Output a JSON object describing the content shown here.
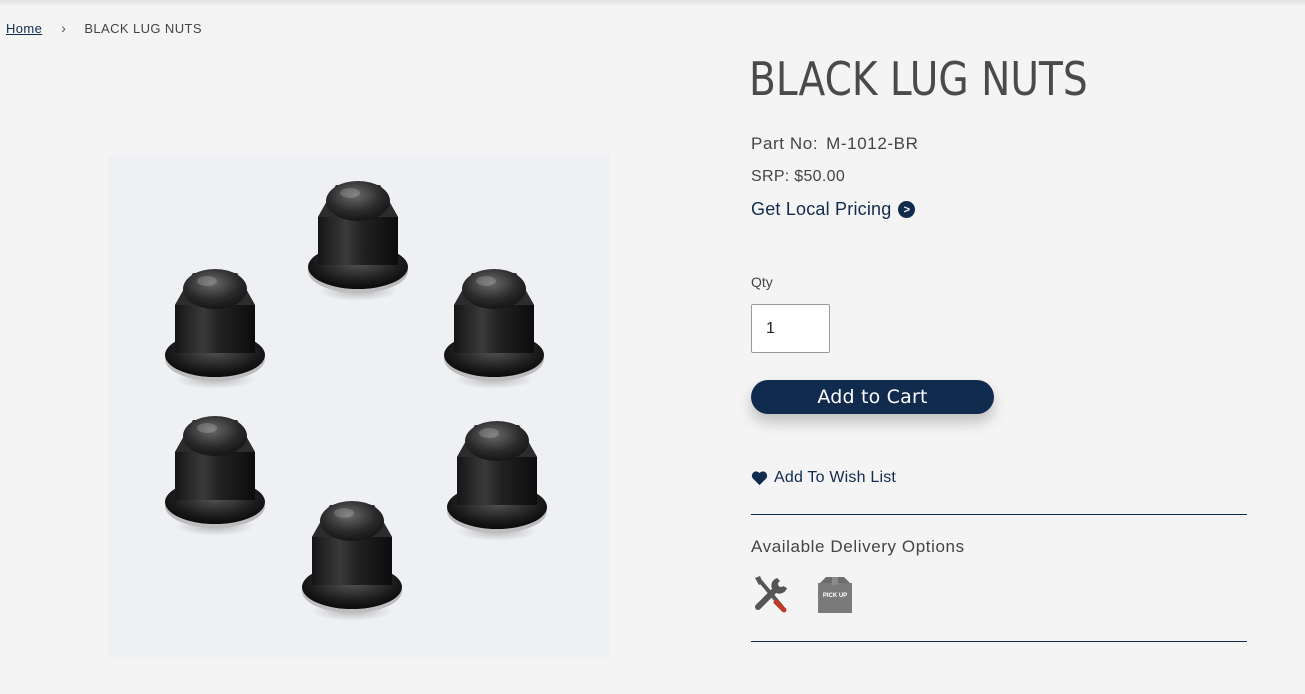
{
  "breadcrumb": {
    "home": "Home",
    "separator": "›",
    "current": "BLACK LUG NUTS"
  },
  "product": {
    "title": "BLACK LUG NUTS",
    "part_label": "Part No:",
    "part_number": "M-1012-BR",
    "srp": "SRP: $50.00",
    "local_pricing": "Get Local Pricing",
    "image_alt": "Black lug nuts product image"
  },
  "purchase": {
    "qty_label": "Qty",
    "qty_value": "1",
    "add_to_cart": "Add to Cart",
    "wish_list": "Add To Wish List"
  },
  "delivery": {
    "title": "Available Delivery Options",
    "pickup_text": "PICK UP",
    "icons": [
      "wrench-screwdriver-icon",
      "pickup-box-icon"
    ]
  },
  "colors": {
    "brand_navy": "#102b4e",
    "background": "#f4f4f4"
  }
}
